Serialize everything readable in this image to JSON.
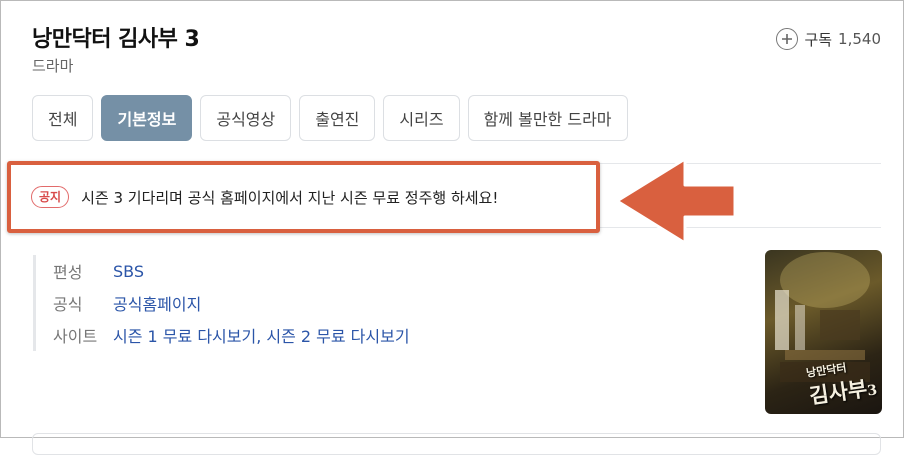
{
  "header": {
    "title": "낭만닥터 김사부 3",
    "genre": "드라마",
    "subscribe_label": "구독",
    "subscribe_count": "1,540"
  },
  "tabs": [
    {
      "label": "전체",
      "active": false
    },
    {
      "label": "기본정보",
      "active": true
    },
    {
      "label": "공식영상",
      "active": false
    },
    {
      "label": "출연진",
      "active": false
    },
    {
      "label": "시리즈",
      "active": false
    },
    {
      "label": "함께 볼만한 드라마",
      "active": false
    }
  ],
  "notice": {
    "badge": "공지",
    "text": "시즌 3 기다리며 공식 홈페이지에서 지난 시즌 무료 정주행 하세요!"
  },
  "info": {
    "rows": [
      {
        "label": "편성",
        "value": "SBS"
      },
      {
        "label": "공식",
        "value": "공식홈페이지"
      },
      {
        "label": "사이트",
        "value": "시즌 1 무료 다시보기, 시즌 2 무료 다시보기"
      }
    ]
  },
  "poster": {
    "title_line1": "낭만닥터",
    "title_line2": "김사부",
    "title_num": "3"
  },
  "colors": {
    "accent_tab": "#7590a6",
    "highlight": "#d9603f",
    "link": "#2b55a8"
  }
}
